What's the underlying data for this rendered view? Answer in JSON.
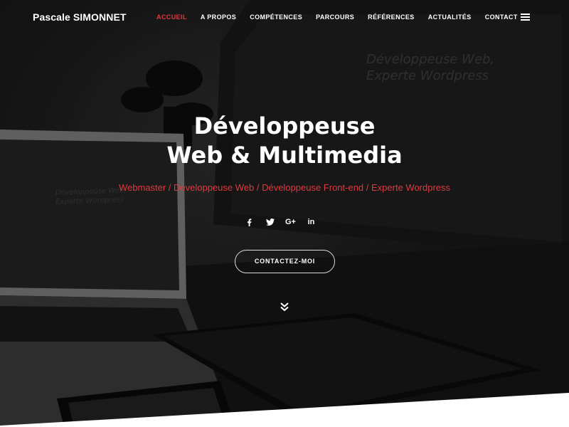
{
  "navbar": {
    "brand": "Pascale SIMONNET",
    "items": [
      {
        "label": "ACCUEIL",
        "active": true
      },
      {
        "label": "A PROPOS",
        "active": false
      },
      {
        "label": "COMPÉTENCES",
        "active": false
      },
      {
        "label": "PARCOURS",
        "active": false
      },
      {
        "label": "RÉFÉRENCES",
        "active": false
      },
      {
        "label": "ACTUALITÉS",
        "active": false
      },
      {
        "label": "CONTACT",
        "active": false
      }
    ],
    "menu_icon": "hamburger-icon"
  },
  "hero": {
    "title_line1": "Développeuse",
    "title_line2": "Web & Multimedia",
    "subtitle": "Webmaster / Developpeuse Web / Développeuse Front-end / Experte Wordpress",
    "social": [
      {
        "icon": "facebook-icon"
      },
      {
        "icon": "twitter-icon"
      },
      {
        "icon": "google-plus-icon",
        "label": "G+"
      },
      {
        "icon": "linkedin-icon",
        "label": "in"
      }
    ],
    "cta_label": "CONTACTEZ-MOI",
    "scroll_icon": "double-chevron-down-icon"
  },
  "background": {
    "monitor_title_line1": "Développeuse Web,",
    "monitor_title_line2": "Experte Wordpress",
    "laptop_title_line1": "Développeuse Web,",
    "laptop_title_line2": "Experte Wordpress"
  },
  "colors": {
    "accent": "#e0393e",
    "text": "#ffffff",
    "bottom_band": "#ffffff"
  }
}
